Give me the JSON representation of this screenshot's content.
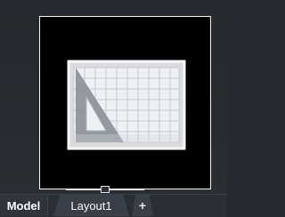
{
  "tabs": [
    {
      "label": "Model",
      "selected": true
    },
    {
      "label": "Layout1",
      "selected": false
    },
    {
      "label": "+",
      "selected": false
    }
  ],
  "preview": {
    "icon": "sheet-with-triangle-icon"
  },
  "colors": {
    "background": "#27292d",
    "tab_strip": "#2b2f35",
    "tab_layout_bg": "#3a3f47"
  }
}
